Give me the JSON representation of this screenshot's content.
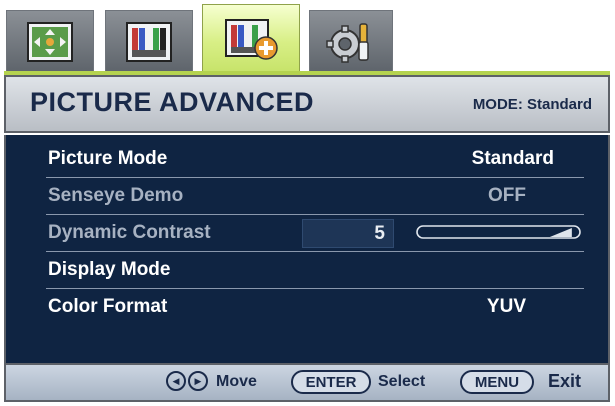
{
  "tabs": [
    {
      "name": "display-settings-icon",
      "active": false
    },
    {
      "name": "picture-icon",
      "active": false
    },
    {
      "name": "picture-advanced-icon",
      "active": true
    },
    {
      "name": "system-settings-icon",
      "active": false
    }
  ],
  "header": {
    "title": "PICTURE ADVANCED",
    "mode": "MODE: Standard"
  },
  "menu": {
    "picture_mode": {
      "label": "Picture Mode",
      "value": "Standard"
    },
    "senseye_demo": {
      "label": "Senseye Demo",
      "value": "OFF"
    },
    "dynamic_contrast": {
      "label": "Dynamic Contrast",
      "value": "5",
      "level_fraction": 0.95
    },
    "display_mode": {
      "label": "Display Mode"
    },
    "color_format": {
      "label": "Color Format",
      "value": "YUV"
    }
  },
  "footer": {
    "move": "Move",
    "enter_key": "ENTER",
    "select": "Select",
    "menu_key": "MENU",
    "exit": "Exit"
  },
  "colors": {
    "panel": "#0f2442",
    "active_tab": "#d8ef86",
    "header": "#c9ced4",
    "footer": "#b8c4d2"
  }
}
